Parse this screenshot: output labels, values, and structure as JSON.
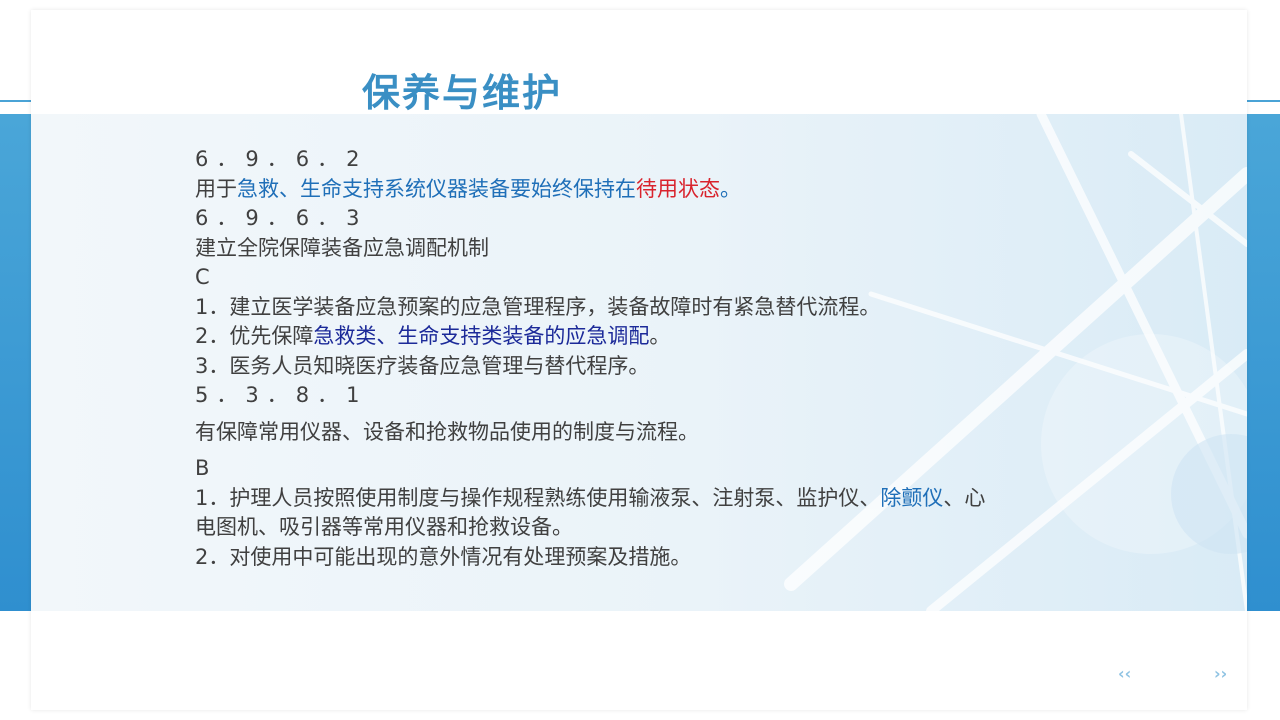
{
  "title": "保养与维护",
  "lines": {
    "l1": "6．9．6．2",
    "l2_a": "用于",
    "l2_b": "急救、生命支持系统仪器装备要始终保持在",
    "l2_c": "待用状态",
    "l2_d": "。",
    "l3": "6．9．6．3",
    "l4": "建立全院保障装备应急调配机制",
    "l5": "C",
    "l6": "1．建立医学装备应急预案的应急管理程序，装备故障时有紧急替代流程。",
    "l7_a": "2．优先保障",
    "l7_b": "急救类、生命支持类装备的应急调配",
    "l7_c": "。",
    "l8": "3．医务人员知晓医疗装备应急管理与替代程序。",
    "l9": "5．3．8．1",
    "l10": "有保障常用仪器、设备和抢救物品使用的制度与流程。",
    "l11": "B",
    "l12_a": "1．护理人员按照使用制度与操作规程熟练使用输液泵、注射泵、监护仪、",
    "l12_b": "除颤仪",
    "l12_c": "、心",
    "l13": "电图机、吸引器等常用仪器和抢救设备。",
    "l14": "2．对使用中可能出现的意外情况有处理预案及措施。"
  },
  "nav": {
    "prev": "‹‹",
    "next": "››"
  },
  "colors": {
    "title": "#3a8fc4",
    "highlight_blue": "#1f6fb8",
    "highlight_red": "#d9232d",
    "highlight_navy": "#1c2a99"
  }
}
